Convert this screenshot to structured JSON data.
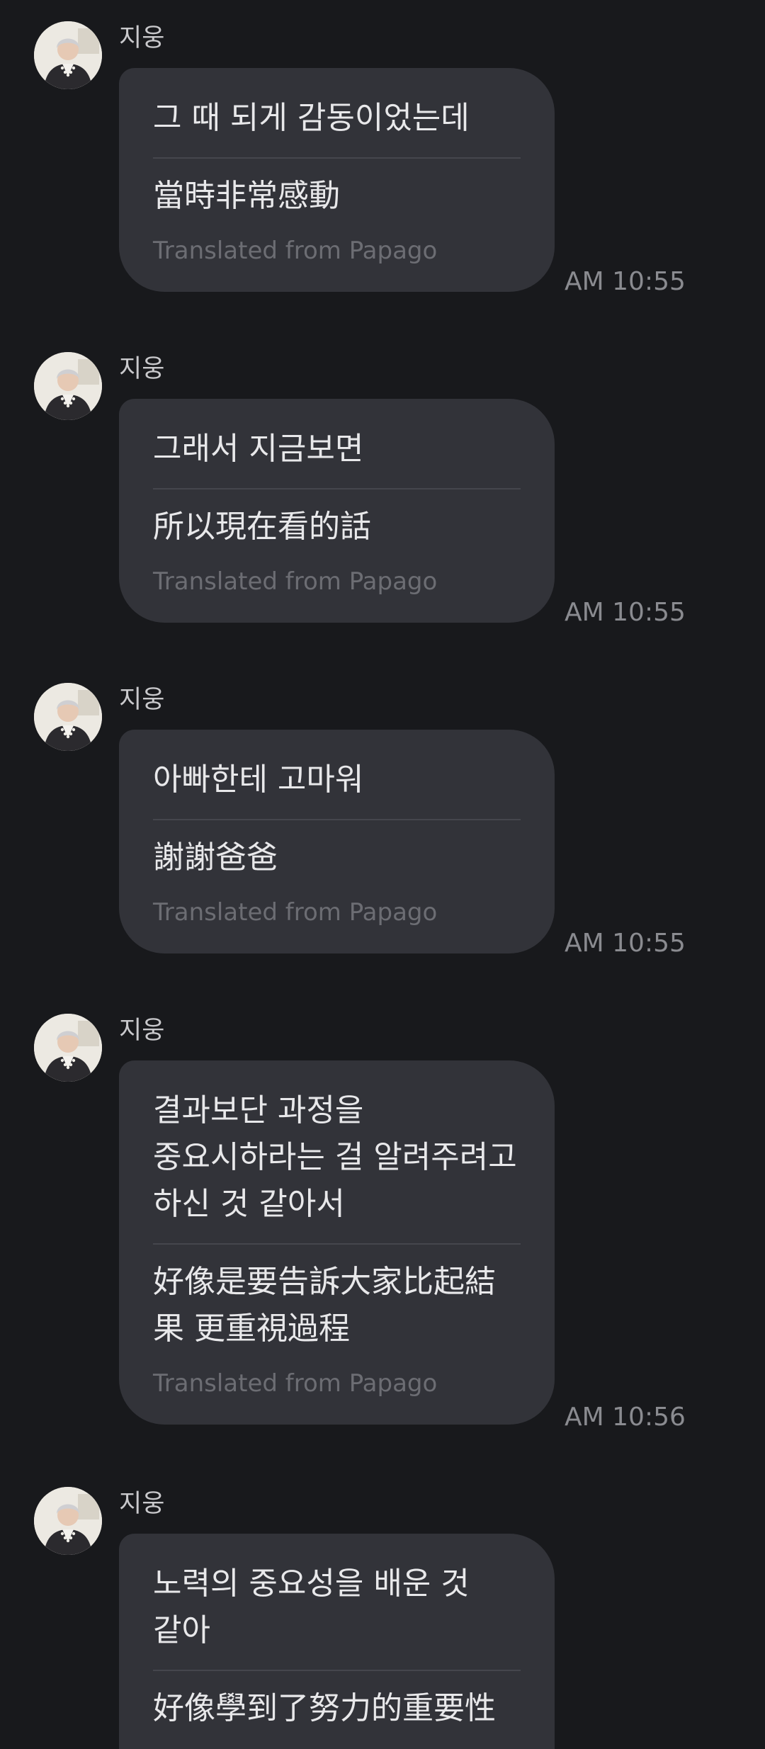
{
  "messages": [
    {
      "sender": "지웅",
      "original": "그 때 되게 감동이었는데",
      "translation": "當時非常感動",
      "credit": "Translated from Papago",
      "time": "AM 10:55"
    },
    {
      "sender": "지웅",
      "original": "그래서 지금보면",
      "translation": "所以現在看的話",
      "credit": "Translated from Papago",
      "time": "AM 10:55"
    },
    {
      "sender": "지웅",
      "original": "아빠한테 고마워",
      "translation": "謝謝爸爸",
      "credit": "Translated from Papago",
      "time": "AM 10:55"
    },
    {
      "sender": "지웅",
      "original": "결과보단 과정을 중요시하라는 걸 알려주려고 하신 것 같아서",
      "translation": "好像是要告訴大家比起結果 更重視過程",
      "credit": "Translated from Papago",
      "time": "AM 10:56"
    },
    {
      "sender": "지웅",
      "original": "노력의 중요성을 배운 것 같아",
      "translation": "好像學到了努力的重要性",
      "credit": "",
      "time": ""
    }
  ]
}
